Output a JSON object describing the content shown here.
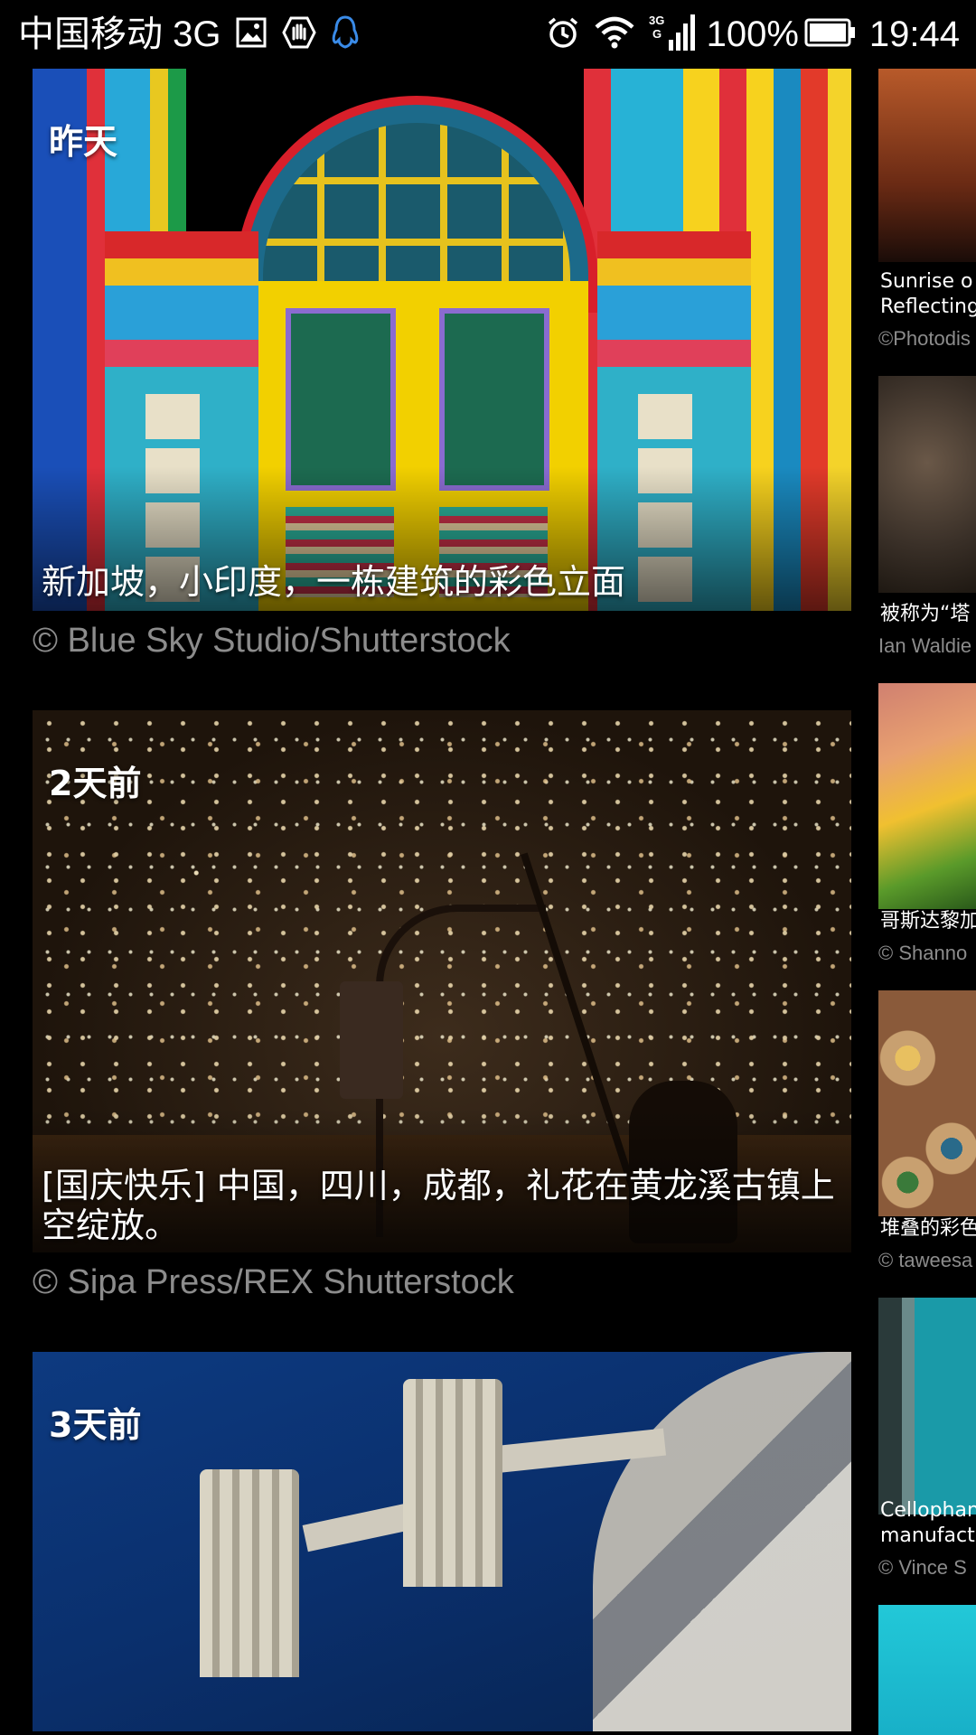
{
  "status_bar": {
    "carrier": "中国移动 3G",
    "battery": "100%",
    "time": "19:44"
  },
  "cards": [
    {
      "age": "昨天",
      "caption": "新加坡，小印度，一栋建筑的彩色立面",
      "credit": "© Blue Sky Studio/Shutterstock"
    },
    {
      "age": "2天前",
      "caption": "[国庆快乐] 中国，四川，成都，礼花在黄龙溪古镇上空绽放。",
      "credit": "© Sipa Press/REX Shutterstock"
    },
    {
      "age": "3天前"
    }
  ],
  "side_cards": [
    {
      "caption": "Sunrise o\nReflecting",
      "credit": "©Photodis"
    },
    {
      "caption": "被称为“塔",
      "credit": "Ian Waldie"
    },
    {
      "caption": "哥斯达黎加",
      "credit": "© Shanno"
    },
    {
      "caption": "堆叠的彩色",
      "credit": "© taweesa"
    },
    {
      "caption": "Cellophan\nmanufact",
      "credit": "© Vince S"
    }
  ],
  "colors": {
    "background": "#000000",
    "credit_text": "#8c8c8c",
    "text": "#ffffff"
  }
}
